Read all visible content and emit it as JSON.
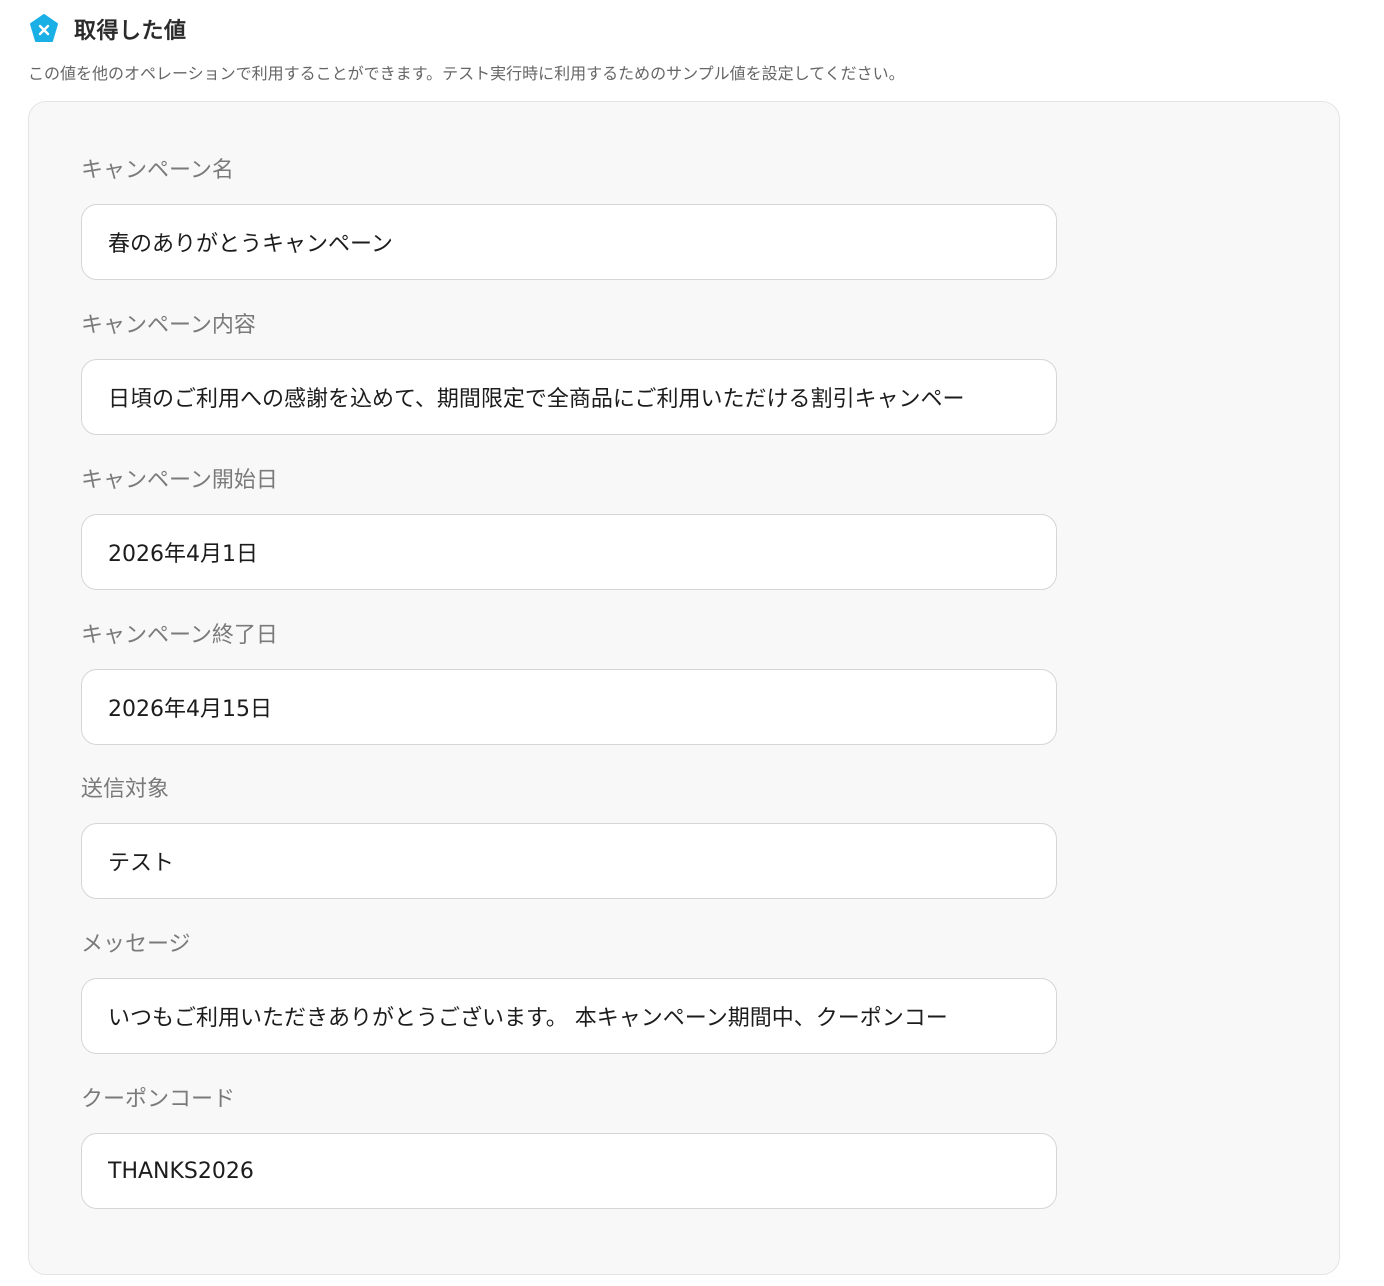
{
  "header": {
    "title": "取得した値",
    "icon": "variable-x-icon",
    "icon_color": "#1ab0e6"
  },
  "description": "この値を他のオペレーションで利用することができます。テスト実行時に利用するためのサンプル値を設定してください。",
  "fields": [
    {
      "label": "キャンペーン名",
      "value": "春のありがとうキャンペーン"
    },
    {
      "label": "キャンペーン内容",
      "value": "日頃のご利用への感謝を込めて、期間限定で全商品にご利用いただける割引キャンペー"
    },
    {
      "label": "キャンペーン開始日",
      "value": "2026年4月1日"
    },
    {
      "label": "キャンペーン終了日",
      "value": "2026年4月15日"
    },
    {
      "label": "送信対象",
      "value": "テスト"
    },
    {
      "label": "メッセージ",
      "value": "いつもご利用いただきありがとうございます。 本キャンペーン期間中、クーポンコー"
    },
    {
      "label": "クーポンコード",
      "value": "THANKS2026"
    }
  ]
}
